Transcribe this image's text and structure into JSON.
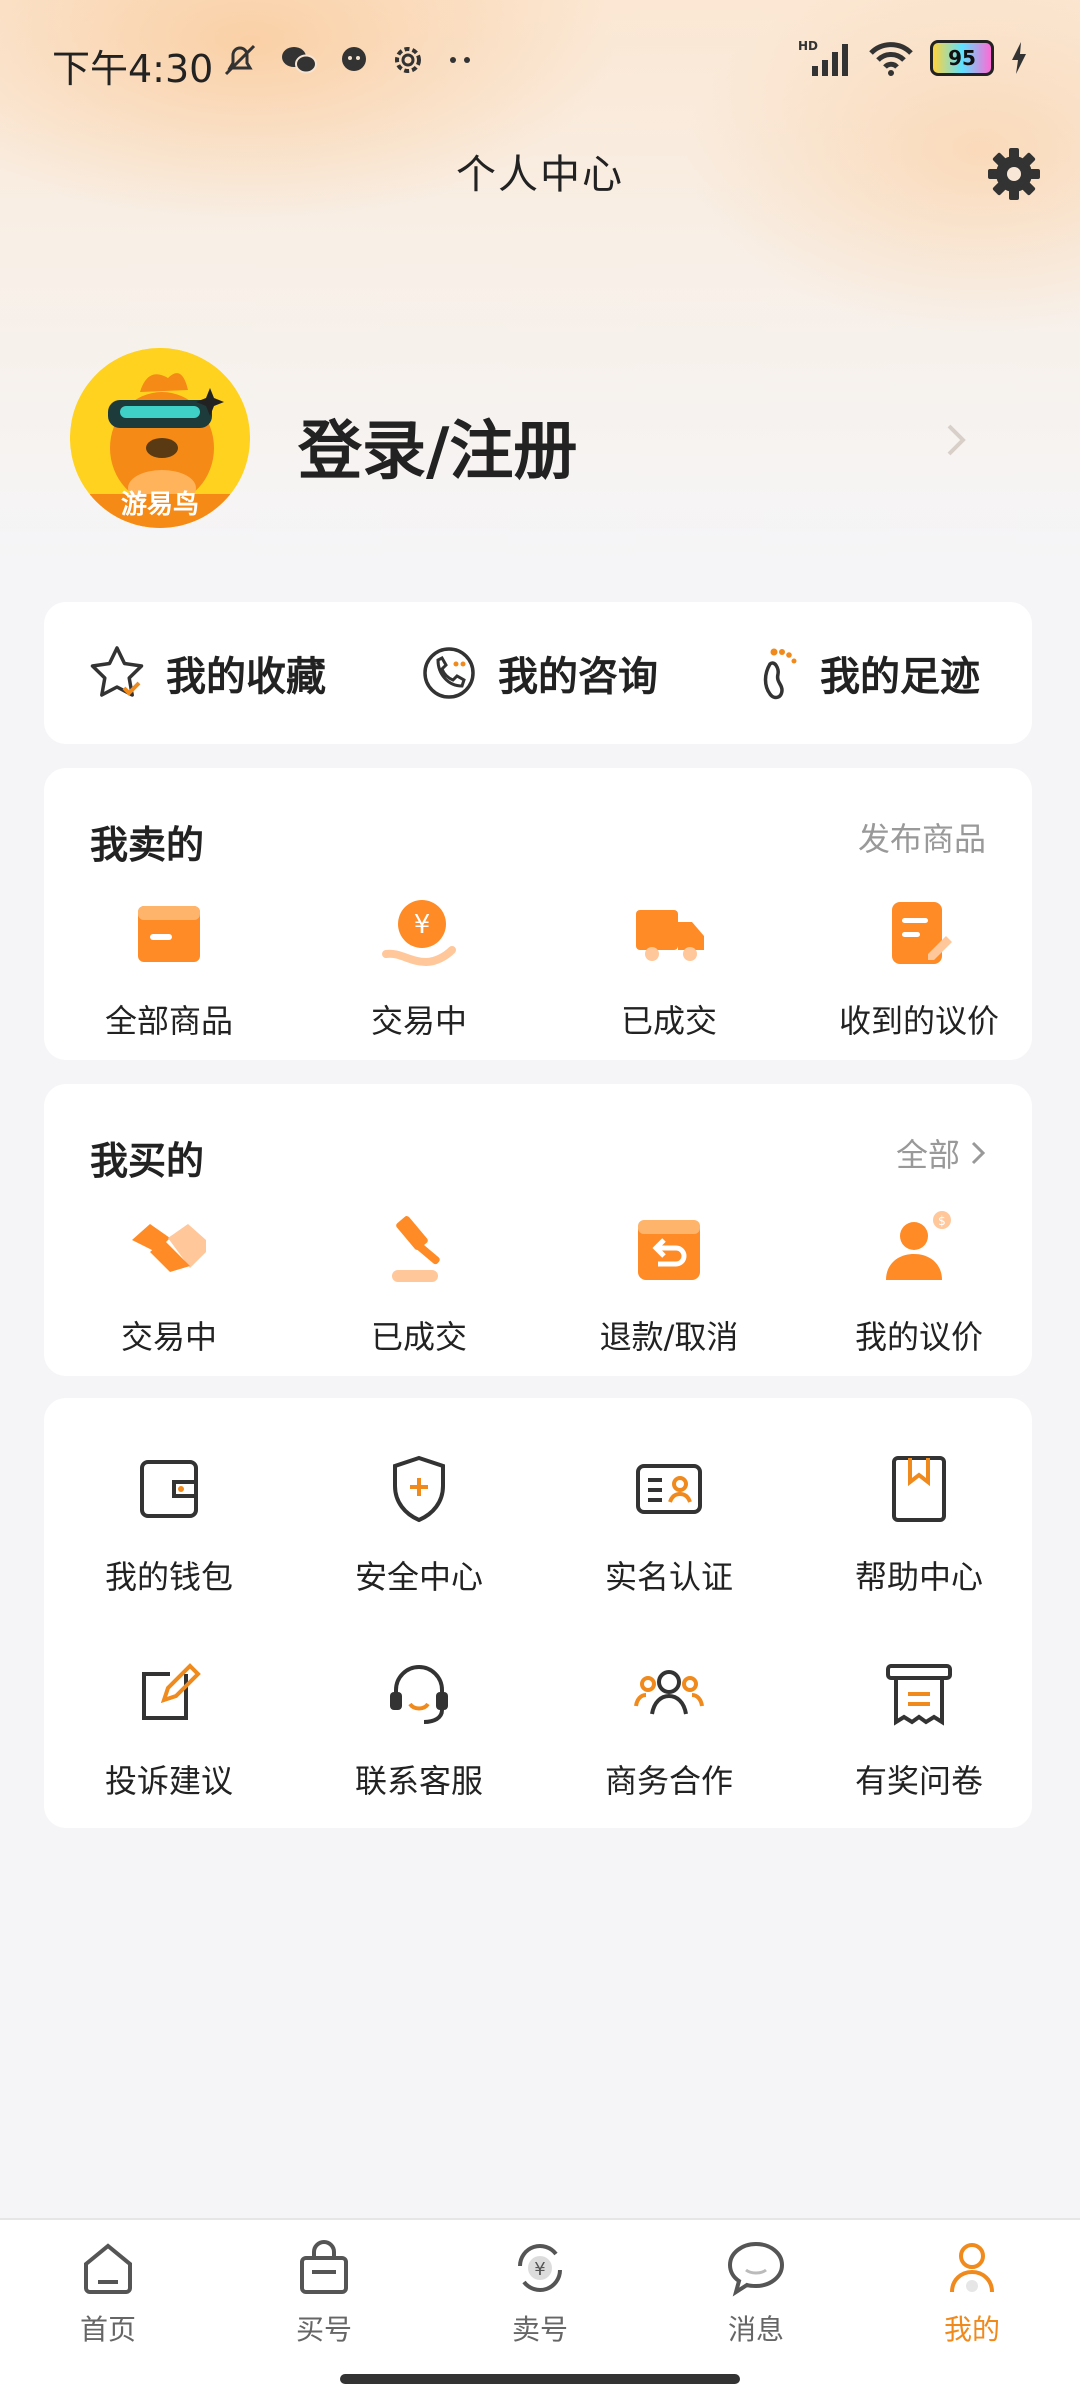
{
  "status_bar": {
    "time": "下午4:30",
    "battery": "95",
    "network": "HD"
  },
  "header": {
    "title": "个人中心"
  },
  "profile": {
    "login_label": "登录/注册",
    "avatar_text": "游易鸟"
  },
  "quick_links": [
    {
      "label": "我的收藏",
      "icon": "star-icon"
    },
    {
      "label": "我的咨询",
      "icon": "phone-chat-icon"
    },
    {
      "label": "我的足迹",
      "icon": "footprint-icon"
    }
  ],
  "selling": {
    "title": "我卖的",
    "action": "发布商品",
    "items": [
      {
        "label": "全部商品",
        "icon": "box-icon"
      },
      {
        "label": "交易中",
        "icon": "coin-hand-icon"
      },
      {
        "label": "已成交",
        "icon": "truck-icon"
      },
      {
        "label": "收到的议价",
        "icon": "note-edit-icon"
      }
    ]
  },
  "buying": {
    "title": "我买的",
    "action": "全部",
    "items": [
      {
        "label": "交易中",
        "icon": "handshake-icon"
      },
      {
        "label": "已成交",
        "icon": "gavel-icon"
      },
      {
        "label": "退款/取消",
        "icon": "refund-box-icon"
      },
      {
        "label": "我的议价",
        "icon": "person-bid-icon"
      }
    ]
  },
  "services": {
    "items": [
      {
        "label": "我的钱包",
        "icon": "wallet-icon"
      },
      {
        "label": "安全中心",
        "icon": "shield-icon"
      },
      {
        "label": "实名认证",
        "icon": "id-card-icon"
      },
      {
        "label": "帮助中心",
        "icon": "bookmark-icon"
      },
      {
        "label": "投诉建议",
        "icon": "edit-icon"
      },
      {
        "label": "联系客服",
        "icon": "headset-icon"
      },
      {
        "label": "商务合作",
        "icon": "group-icon"
      },
      {
        "label": "有奖问卷",
        "icon": "receipt-icon"
      }
    ]
  },
  "tabbar": [
    {
      "label": "首页",
      "icon": "home-icon"
    },
    {
      "label": "买号",
      "icon": "shopping-bag-icon"
    },
    {
      "label": "卖号",
      "icon": "exchange-coin-icon"
    },
    {
      "label": "消息",
      "icon": "chat-bubble-icon"
    },
    {
      "label": "我的",
      "icon": "user-icon",
      "active": true
    }
  ],
  "colors": {
    "accent": "#f08a1c",
    "text": "#222222",
    "muted": "#999999"
  }
}
